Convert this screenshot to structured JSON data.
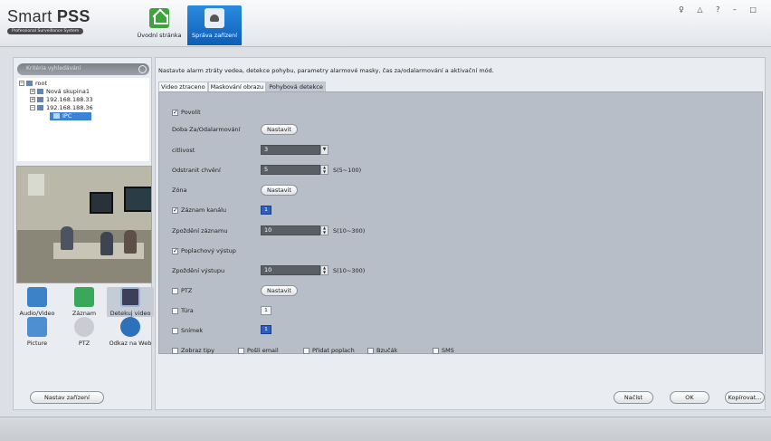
{
  "app": {
    "name": "Smart PSS",
    "name_plain": "Smart ",
    "name_bold": "PSS",
    "subtitle": "Professional Surveillance System"
  },
  "nav": {
    "home_label": "Úvodní stránka",
    "device_label": "Správa zařízení"
  },
  "window_controls": {
    "text": "♀ △ ? – □"
  },
  "left": {
    "search_placeholder": "Kritéria vyhledávání",
    "tree": [
      {
        "label": "root"
      },
      {
        "label": "Nová skupina1"
      },
      {
        "label": "192.168.188.33"
      },
      {
        "label": "192.168.188.36"
      },
      {
        "label": "IPC"
      }
    ],
    "tools": [
      {
        "label": "Audio/Video",
        "icon": "microphone-icon"
      },
      {
        "label": "Záznam",
        "icon": "recording-icon"
      },
      {
        "label": "Detekuj video",
        "icon": "detect-video-icon"
      },
      {
        "label": "Picture",
        "icon": "picture-icon"
      },
      {
        "label": "PTZ",
        "icon": "ptz-icon"
      },
      {
        "label": "Odkaz na Web",
        "icon": "web-icon"
      }
    ],
    "setup_button": "Nastav zařízení"
  },
  "main": {
    "description": "Nastavte alarm ztráty vedea, detekce pohybu, parametry alarmové masky, čas za/odalarmování a aktivační mód.",
    "tabs": [
      "Video ztraceno",
      "Maskování obrazu",
      "Pohybová detekce"
    ],
    "form": {
      "enable_label": "Povolit",
      "arm_time_label": "Doba Za/Odalarmování",
      "set_button": "Nastavit",
      "sensitivity_label": "citlivost",
      "sensitivity_value": "3",
      "anti_dither_label": "Odstranit chvění",
      "anti_dither_value": "5",
      "anti_dither_range": "S(5~100)",
      "zone_label": "Zóna",
      "channel_record_label": "Záznam kanálu",
      "channel_record_value": "1",
      "record_delay_label": "Zpoždění záznamu",
      "record_delay_value": "10",
      "record_delay_range": "S(10~300)",
      "alarm_output_label": "Poplachový výstup",
      "output_delay_label": "Zpoždění výstupu",
      "output_delay_value": "10",
      "output_delay_range": "S(10~300)",
      "ptz_label": "PTZ",
      "tour_label": "Túra",
      "tour_value": "1",
      "snapshot_label": "Snímek",
      "snapshot_value": "1",
      "show_tips_label": "Zobraz tipy",
      "send_email_label": "Pošli email",
      "add_alarm_label": "Přidat poplach",
      "buzzer_label": "Bzučák",
      "sms_label": "SMS"
    },
    "buttons": {
      "load": "Načíst",
      "ok": "OK",
      "copy": "Kopírovat..."
    }
  },
  "colors": {
    "accent": "#1a72cf",
    "panel": "#b8bec7",
    "field": "#5a5f66"
  }
}
